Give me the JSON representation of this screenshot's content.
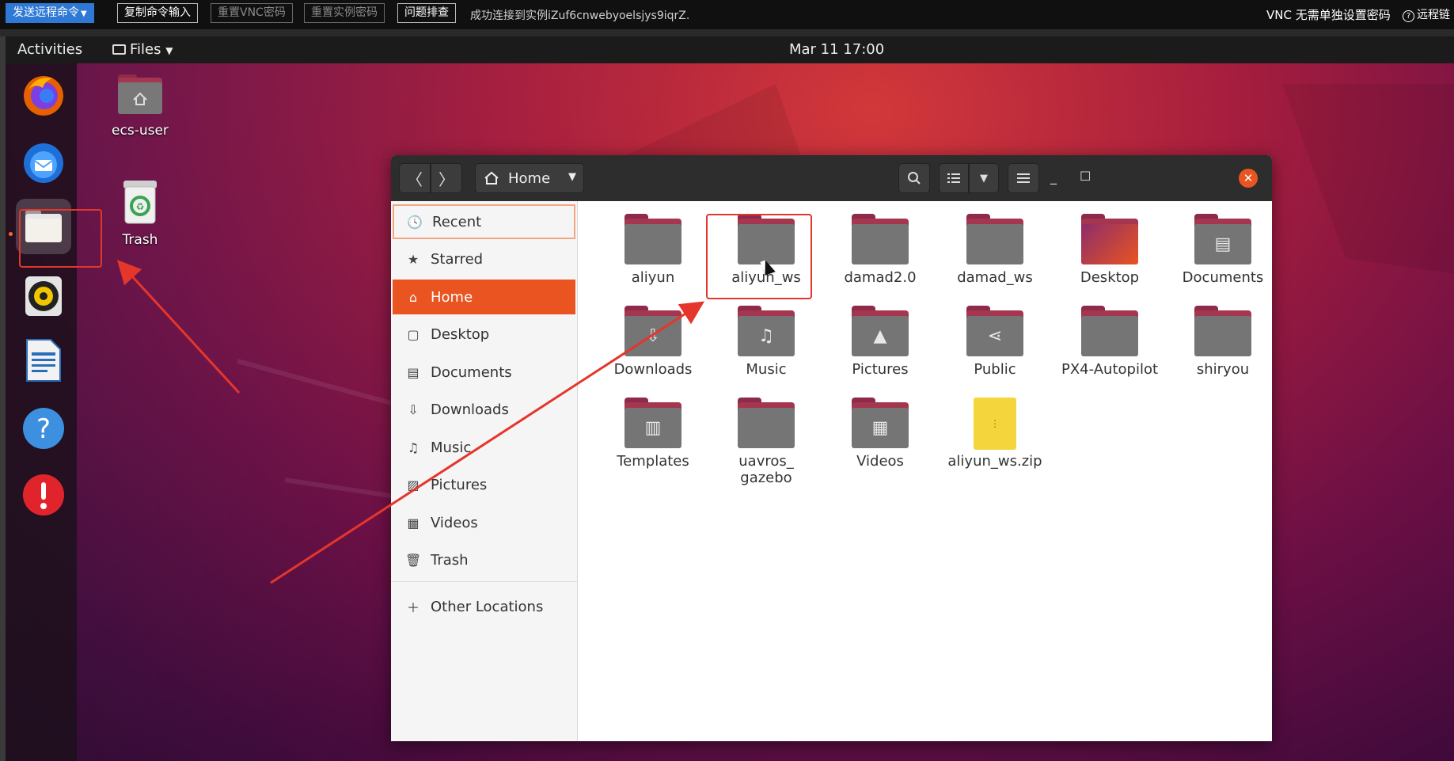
{
  "vnc_toolbar": {
    "send_command": "发送远程命令",
    "copy_input": "复制命令输入",
    "reset_vnc_password": "重置VNC密码",
    "reset_instance_password": "重置实例密码",
    "troubleshoot": "问题排查",
    "status": "成功连接到实例iZuf6cnwebyoelsjys9iqrZ.",
    "vnc_password_setting": "VNC 无需单独设置密码",
    "remote_link": "远程链"
  },
  "topbar": {
    "activities": "Activities",
    "files_menu": "Files",
    "clock": "Mar 11  17:00"
  },
  "dock": {
    "items": [
      "firefox-icon",
      "thunderbird-icon",
      "files-icon",
      "rhythmbox-icon",
      "libreoffice-writer-icon",
      "help-icon",
      "software-updater-icon"
    ],
    "active_item": "files-icon"
  },
  "desktop_icons": [
    {
      "label": "ecs-user"
    },
    {
      "label": "Trash"
    }
  ],
  "window": {
    "path": "Home",
    "sidebar": [
      {
        "label": "Recent",
        "icon": "clock-icon"
      },
      {
        "label": "Starred",
        "icon": "star-icon"
      },
      {
        "label": "Home",
        "icon": "home-icon",
        "selected": true
      },
      {
        "label": "Desktop",
        "icon": "desktop-icon"
      },
      {
        "label": "Documents",
        "icon": "documents-icon"
      },
      {
        "label": "Downloads",
        "icon": "download-icon"
      },
      {
        "label": "Music",
        "icon": "music-icon"
      },
      {
        "label": "Pictures",
        "icon": "pictures-icon"
      },
      {
        "label": "Videos",
        "icon": "videos-icon"
      },
      {
        "label": "Trash",
        "icon": "trash-icon"
      },
      {
        "label": "Other Locations",
        "icon": "plus-icon"
      }
    ],
    "files": [
      {
        "name": "aliyun"
      },
      {
        "name": "aliyun_ws"
      },
      {
        "name": "damad2.0"
      },
      {
        "name": "damad_ws"
      },
      {
        "name": "Desktop"
      },
      {
        "name": "Documents"
      },
      {
        "name": "Downloads"
      },
      {
        "name": "Music"
      },
      {
        "name": "Pictures"
      },
      {
        "name": "Public"
      },
      {
        "name": "PX4-Autopilot"
      },
      {
        "name": "shiryou"
      },
      {
        "name": "Templates"
      },
      {
        "name": "uavros_ gazebo"
      },
      {
        "name": "Videos"
      },
      {
        "name": "aliyun_ws.zip"
      }
    ]
  },
  "colors": {
    "accent": "#e95420",
    "annotation": "#e4362b",
    "vnc_primary": "#2f79d6"
  }
}
